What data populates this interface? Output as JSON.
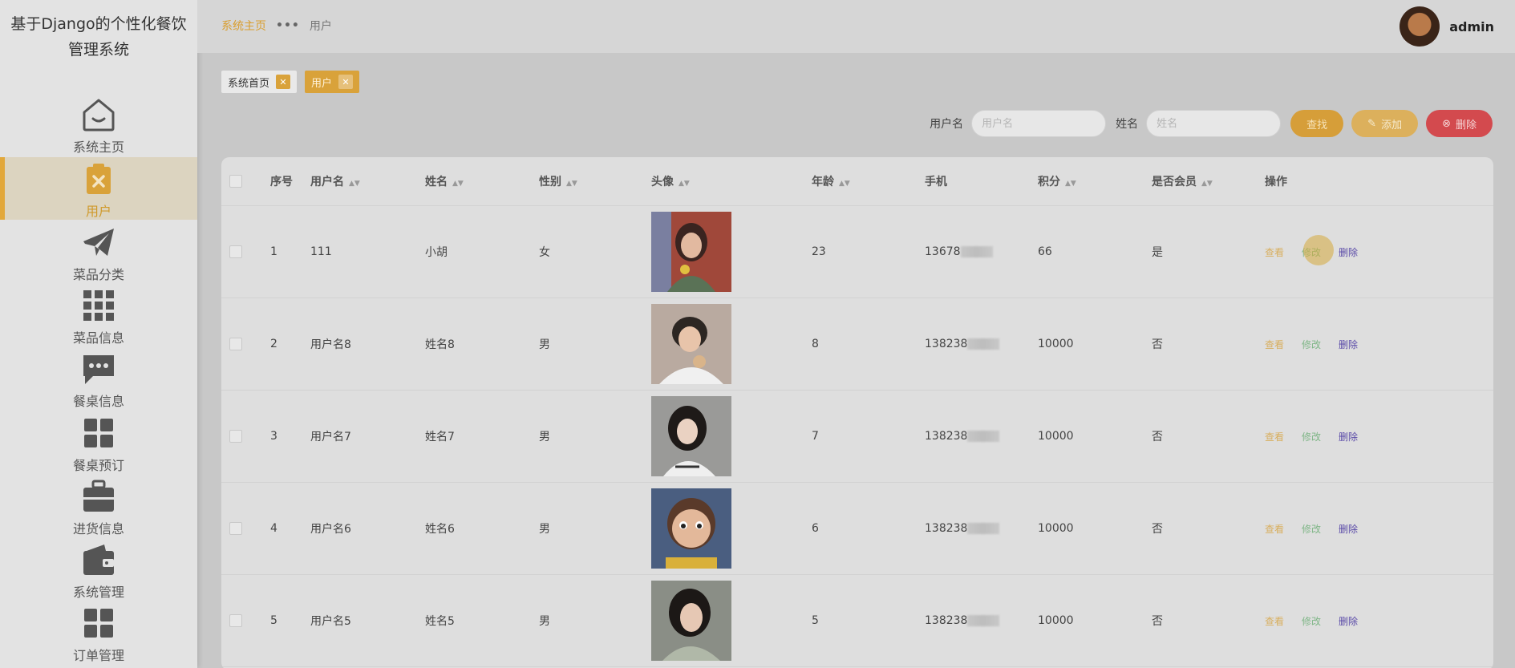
{
  "app": {
    "title_line1": "基于Django的个性化餐饮",
    "title_line2": "管理系统"
  },
  "sidebar": {
    "items": [
      {
        "label": "系统主页",
        "icon": "home-icon"
      },
      {
        "label": "用户",
        "icon": "clipboard-icon",
        "active": true
      },
      {
        "label": "菜品分类",
        "icon": "paper-plane-icon"
      },
      {
        "label": "菜品信息",
        "icon": "grid-icon"
      },
      {
        "label": "餐桌信息",
        "icon": "chat-icon"
      },
      {
        "label": "餐桌预订",
        "icon": "apps-icon"
      },
      {
        "label": "进货信息",
        "icon": "briefcase-icon"
      },
      {
        "label": "系统管理",
        "icon": "wallet-icon"
      },
      {
        "label": "订单管理",
        "icon": "apps-icon"
      }
    ]
  },
  "header": {
    "breadcrumb_home": "系统主页",
    "breadcrumb_sep": "•••",
    "breadcrumb_current": "用户",
    "username": "admin"
  },
  "tabs": [
    {
      "label": "系统首页"
    },
    {
      "label": "用户",
      "active": true
    }
  ],
  "search": {
    "username_label": "用户名",
    "username_placeholder": "用户名",
    "name_label": "姓名",
    "name_placeholder": "姓名",
    "query_button": "查找",
    "add_button": "添加",
    "delete_button": "删除"
  },
  "table": {
    "columns": [
      "序号",
      "用户名",
      "姓名",
      "性别",
      "头像",
      "年龄",
      "手机",
      "积分",
      "是否会员",
      "操作"
    ],
    "rows": [
      {
        "index": "1",
        "username": "111",
        "name": "小胡",
        "gender": "女",
        "age": "23",
        "phone": "13678",
        "points": "66",
        "member": "是"
      },
      {
        "index": "2",
        "username": "用户名8",
        "name": "姓名8",
        "gender": "男",
        "age": "8",
        "phone": "138238",
        "points": "10000",
        "member": "否"
      },
      {
        "index": "3",
        "username": "用户名7",
        "name": "姓名7",
        "gender": "男",
        "age": "7",
        "phone": "138238",
        "points": "10000",
        "member": "否"
      },
      {
        "index": "4",
        "username": "用户名6",
        "name": "姓名6",
        "gender": "男",
        "age": "6",
        "phone": "138238",
        "points": "10000",
        "member": "否"
      },
      {
        "index": "5",
        "username": "用户名5",
        "name": "姓名5",
        "gender": "男",
        "age": "5",
        "phone": "138238",
        "points": "10000",
        "member": "否"
      }
    ],
    "op_view": "查看",
    "op_edit": "修改",
    "op_delete": "删除"
  },
  "colors": {
    "accent": "#d9a23a",
    "danger": "#d34a4e",
    "edit": "#7fb687",
    "delete_link": "#5a4aa8"
  }
}
